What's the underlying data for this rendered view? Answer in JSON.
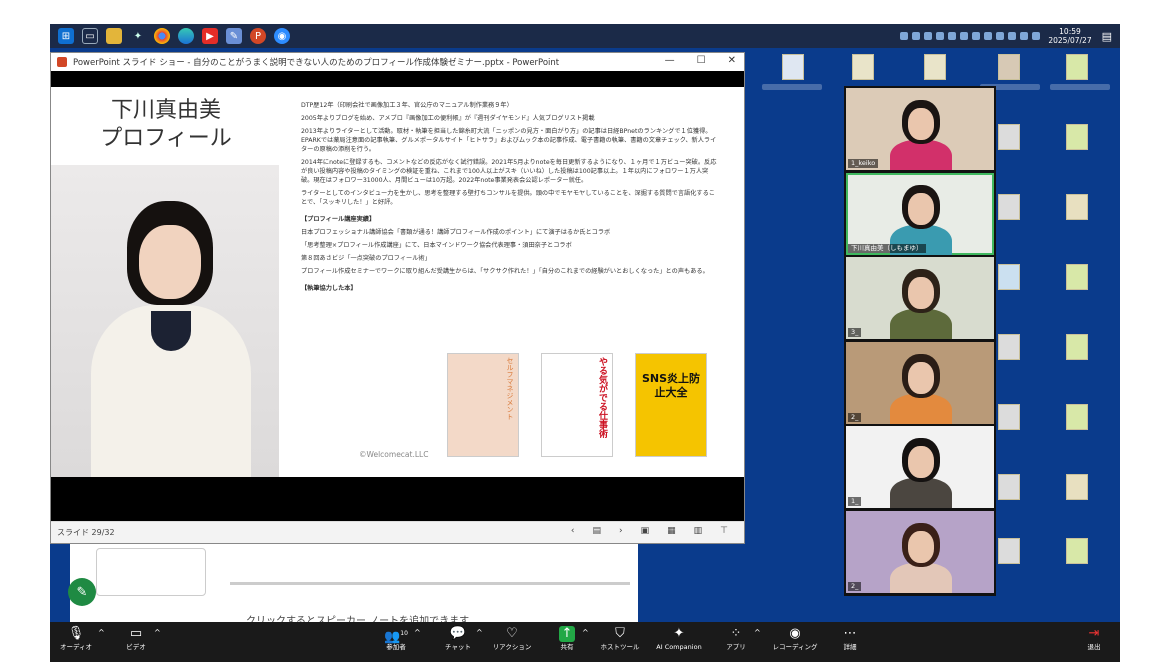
{
  "taskbar": {
    "icons": [
      "windows-start-icon",
      "task-view-icon",
      "file-explorer-icon",
      "paw-app-icon",
      "chrome-icon",
      "edge-icon",
      "youtube-icon",
      "pen-app-icon",
      "powerpoint-icon",
      "zoom-icon"
    ],
    "clock_time": "10:59",
    "clock_date": "2025/07/27"
  },
  "powerpoint": {
    "window_title": "PowerPoint スライド ショー  -  自分のことがうまく説明できない人のためのプロフィール作成体験ゼミナー.pptx - PowerPoint",
    "slide_counter": "スライド 29/32",
    "slide": {
      "name_line1": "下川真由美",
      "name_line2": "プロフィール",
      "paragraphs": [
        "DTP歴12年（印刷会社で画像加工３年、官公庁のマニュアル制作業務９年）",
        "2005年よりブログを始め、アメブロ『画像加工の便利帳』が『週刊ダイヤモンド』人気ブログリスト掲載",
        "2013年よりライターとして活動。取材・執筆を担当した錦糸町大流「ニッポンの見方・面白がり方」の記事は日経BPnetのランキングで１位獲得。EPARKでは薬局注意面の記事執筆、グルメポータルサイト「ヒトサラ」およびムック本の記事作成、電子書籍の執筆、書籍の文章チェック、新人ライターの原稿の添削を行う。",
        "2014年にnoteに登録するも、コメントなどの反応がなく試行錯誤。2021年5月よりnoteを毎日更新するようになり、１ヶ月で１万ビュー突破。反応が良い投稿内容や投稿のタイミングの検証を重ね、これまで100人以上がスキ（いいね）した投稿は100記事以上。１年以内にフォロワー１万人突破。現在はフォロワー31000人、月間ビューは10万超。2022年note事業発表会公認レポーター就任。",
        "ライターとしてのインタビュー力を生かし、思考を整理する壁打ちコンサルを提供。頭の中でモヤモヤしていることを、深掘する質問で言語化することで、「スッキリした！」と好評。"
      ],
      "section_title": "【プロフィール講座実績】",
      "achievements": [
        "日本プロフェッショナル講師協会「書類が通る！講師プロフィール作成のポイント」にて演子はるか氏とコラボ",
        "「思考整理×プロフィール作成講座」にて、日本マインドワーク協会代表理事・須田奈子とコラボ",
        "第８回あさビジ「一点突破のプロフィール術」",
        "プロフィール作成セミナーでワークに取り組んだ受講生からは、「サクサク作れた！」「自分のこれまでの経験がいとおしくなった」との声もある。"
      ],
      "books_title": "【執筆協力した本】",
      "books": [
        {
          "title": "セルフマネジメント",
          "color": "#f3d9c8"
        },
        {
          "title": "やる気がでる仕事術",
          "color": "#ffffff"
        },
        {
          "title": "SNS炎上防止大全",
          "color": "#f5c400"
        }
      ],
      "copyright": "©Welcomecat.LLC"
    }
  },
  "notes": {
    "placeholder": "クリックするとスピーカー ノートを追加できます"
  },
  "gallery": {
    "participants": [
      {
        "name": "1_keiko",
        "bg": "#dccbb7",
        "shirt": "#d2306a",
        "hair": "#1a1412"
      },
      {
        "name": "下川真由美（しもまゆ）",
        "bg": "#e8ece6",
        "shirt": "#3a9bb0",
        "hair": "#1a1412",
        "active": true
      },
      {
        "name": "3_",
        "bg": "#d8dccf",
        "shirt": "#5d6a3b",
        "hair": "#2d2218"
      },
      {
        "name": "2_",
        "bg": "#b99a78",
        "shirt": "#e38a3e",
        "hair": "#2a1d16"
      },
      {
        "name": "1_",
        "bg": "#f2f2f2",
        "shirt": "#4b4640",
        "hair": "#151211"
      },
      {
        "name": "2_",
        "bg": "#b6a3c8",
        "shirt": "#e3c7b8",
        "hair": "#3a2018"
      }
    ]
  },
  "zoom_toolbar": {
    "audio": "オーディオ",
    "video": "ビデオ",
    "participants": "参加者",
    "participants_count": "10",
    "chat": "チャット",
    "reactions": "リアクション",
    "share": "共有",
    "host_tools": "ホストツール",
    "ai_companion": "AI Companion",
    "apps": "アプリ",
    "recording": "レコーディング",
    "more": "詳細",
    "leave": "退出"
  }
}
